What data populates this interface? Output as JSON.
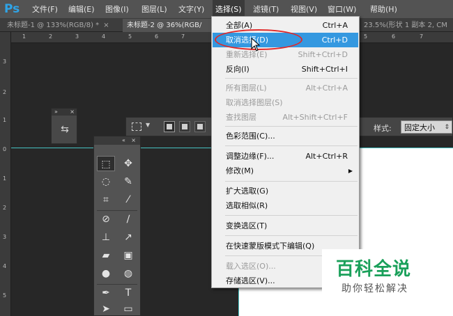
{
  "app": {
    "logo": "Ps"
  },
  "menubar": {
    "items": [
      {
        "label": "文件(F)"
      },
      {
        "label": "编辑(E)"
      },
      {
        "label": "图像(I)"
      },
      {
        "label": "图层(L)"
      },
      {
        "label": "文字(Y)"
      },
      {
        "label": "选择(S)",
        "active": true
      },
      {
        "label": "滤镜(T)"
      },
      {
        "label": "视图(V)"
      },
      {
        "label": "窗口(W)"
      },
      {
        "label": "帮助(H)"
      }
    ]
  },
  "tabs": [
    {
      "label": "未标题-1 @ 133%(RGB/8) *",
      "close": "×"
    },
    {
      "label": "未标题-2 @ 36%(RGB/",
      "close": "×",
      "active": true
    },
    {
      "label": "23.5%(形状 1 副本 2, CM"
    }
  ],
  "ruler": {
    "h_labels": [
      "1",
      "2",
      "3",
      "4",
      "5",
      "6",
      "7",
      "1",
      "2",
      "3",
      "4",
      "5",
      "6",
      "7"
    ],
    "v_labels": [
      "3",
      "2",
      "1",
      "0",
      "1",
      "2",
      "3",
      "4",
      "5"
    ]
  },
  "options_bar": {
    "style_label": "样式:",
    "style_value": "固定大小"
  },
  "select_menu": {
    "items": [
      {
        "label": "全部(A)",
        "shortcut": "Ctrl+A"
      },
      {
        "label": "取消选择(D)",
        "shortcut": "Ctrl+D",
        "highlighted": true
      },
      {
        "label": "重新选择(E)",
        "shortcut": "Shift+Ctrl+D",
        "disabled": true
      },
      {
        "label": "反向(I)",
        "shortcut": "Shift+Ctrl+I"
      },
      {
        "separator": true
      },
      {
        "label": "所有图层(L)",
        "shortcut": "Alt+Ctrl+A",
        "disabled": true
      },
      {
        "label": "取消选择图层(S)",
        "shortcut": "",
        "disabled": true
      },
      {
        "label": "查找图层",
        "shortcut": "Alt+Shift+Ctrl+F",
        "disabled": true
      },
      {
        "separator": true
      },
      {
        "label": "色彩范围(C)...",
        "shortcut": ""
      },
      {
        "separator": true
      },
      {
        "label": "调整边缘(F)...",
        "shortcut": "Alt+Ctrl+R"
      },
      {
        "label": "修改(M)",
        "shortcut": "",
        "submenu": true
      },
      {
        "separator": true
      },
      {
        "label": "扩大选取(G)",
        "shortcut": ""
      },
      {
        "label": "选取相似(R)",
        "shortcut": ""
      },
      {
        "separator": true
      },
      {
        "label": "变换选区(T)",
        "shortcut": ""
      },
      {
        "separator": true
      },
      {
        "label": "在快速蒙版模式下编辑(Q)",
        "shortcut": ""
      },
      {
        "separator": true
      },
      {
        "label": "载入选区(O)...",
        "shortcut": "",
        "disabled": true
      },
      {
        "label": "存储选区(V)...",
        "shortcut": ""
      }
    ]
  },
  "watermark": {
    "title": "百科全说",
    "subtitle": "助你轻松解决"
  },
  "colors": {
    "menu_highlight": "#3498e0",
    "annotation": "#e02a2a",
    "guide": "#46c3c3",
    "watermark_green": "#1aa05a",
    "ps_blue": "#2fa4e7"
  }
}
